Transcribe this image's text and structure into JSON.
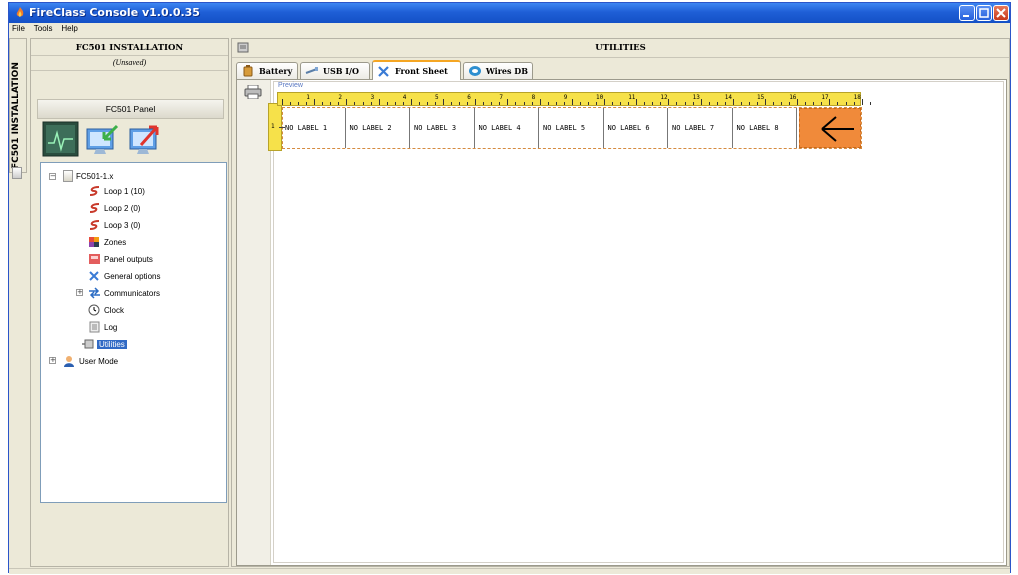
{
  "window": {
    "title": "FireClass Console v1.0.0.35"
  },
  "menu": [
    "File",
    "Tools",
    "Help"
  ],
  "left_panel": {
    "vertical_tab": "FC501 INSTALLATION",
    "header": "FC501 INSTALLATION",
    "subheader": "(Unsaved)",
    "panel_title": "FC501 Panel",
    "tree": {
      "root": "FC501-1.x",
      "items": [
        {
          "label": "Loop 1 (10)",
          "icon": "loop-icon"
        },
        {
          "label": "Loop 2 (0)",
          "icon": "loop-icon"
        },
        {
          "label": "Loop 3 (0)",
          "icon": "loop-icon"
        },
        {
          "label": "Zones",
          "icon": "zones-icon"
        },
        {
          "label": "Panel outputs",
          "icon": "panel-outputs-icon"
        },
        {
          "label": "General options",
          "icon": "general-options-icon"
        },
        {
          "label": "Communicators",
          "icon": "communicators-icon"
        },
        {
          "label": "Clock",
          "icon": "clock-icon"
        },
        {
          "label": "Log",
          "icon": "log-icon"
        },
        {
          "label": "Utilities",
          "icon": "utilities-icon"
        }
      ],
      "user_mode": "User Mode"
    }
  },
  "right_panel": {
    "header": "UTILITIES",
    "tabs": [
      {
        "label": "Battery",
        "icon": "battery-icon"
      },
      {
        "label": "USB I/O",
        "icon": "usb-icon"
      },
      {
        "label": "Front Sheet",
        "icon": "tools-icon",
        "active": true
      },
      {
        "label": "Wires DB",
        "icon": "wires-db-icon"
      }
    ],
    "preview_label": "Preview",
    "ruler_numbers": [
      "1",
      "2",
      "3",
      "4",
      "5",
      "6",
      "7",
      "8",
      "9",
      "10",
      "11",
      "12",
      "13",
      "14",
      "15",
      "16",
      "17",
      "18"
    ],
    "ruler_vertical_number": "1",
    "labels": [
      "NO LABEL 1",
      "NO LABEL 2",
      "NO LABEL 3",
      "NO LABEL 4",
      "NO LABEL 5",
      "NO LABEL 6",
      "NO LABEL 7",
      "NO LABEL 8"
    ]
  },
  "colors": {
    "titlebar": "#1f5fd6",
    "ruler": "#f6e14a",
    "highlight": "#f08a3a",
    "selection": "#316ac5"
  }
}
